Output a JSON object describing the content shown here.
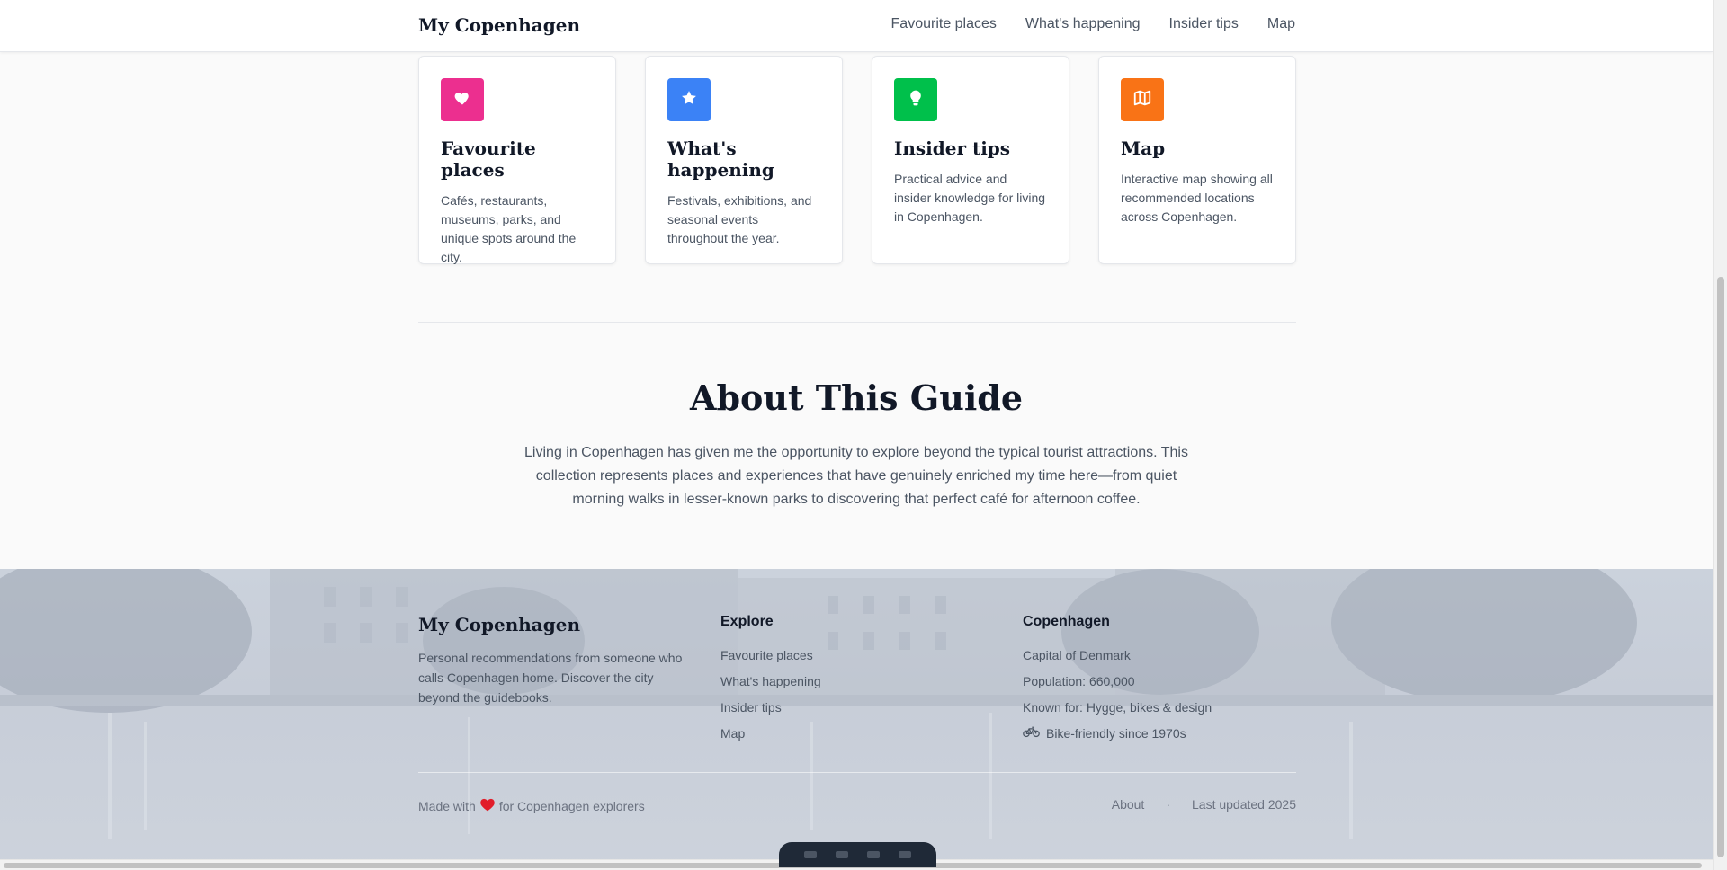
{
  "header": {
    "brand": "My Copenhagen",
    "nav": [
      "Favourite places",
      "What's happening",
      "Insider tips",
      "Map"
    ]
  },
  "cards": [
    {
      "icon": "heart-icon",
      "color": "#ec2f8f",
      "title": "Favourite places",
      "text": "Cafés, restaurants, museums, parks, and unique spots around the city."
    },
    {
      "icon": "star-icon",
      "color": "#3b82f6",
      "title": "What's happening",
      "text": "Festivals, exhibitions, and seasonal events throughout the year."
    },
    {
      "icon": "lightbulb-icon",
      "color": "#00c04b",
      "title": "Insider tips",
      "text": "Practical advice and insider knowledge for living in Copenhagen."
    },
    {
      "icon": "map-icon",
      "color": "#f97316",
      "title": "Map",
      "text": "Interactive map showing all recommended locations across Copenhagen."
    }
  ],
  "about": {
    "title": "About This Guide",
    "text": "Living in Copenhagen has given me the opportunity to explore beyond the typical tourist attractions. This collection represents places and experiences that have genuinely enriched my time here—from quiet morning walks in lesser-known parks to discovering that perfect café for afternoon coffee."
  },
  "footer": {
    "brand": "My Copenhagen",
    "description": "Personal recommendations from someone who calls Copenhagen home. Discover the city beyond the guidebooks.",
    "explore": {
      "heading": "Explore",
      "links": [
        "Favourite places",
        "What's happening",
        "Insider tips",
        "Map"
      ]
    },
    "city": {
      "heading": "Copenhagen",
      "facts": [
        "Capital of Denmark",
        "Population: 660,000",
        "Known for: Hygge, bikes & design"
      ],
      "bike_icon": "bicycle-icon",
      "bike_fact": "Bike-friendly since 1970s"
    },
    "made_prefix": "Made with",
    "made_icon": "heart-icon",
    "made_suffix": "for Copenhagen explorers",
    "about_link": "About",
    "separator": "·",
    "updated": "Last updated 2025"
  }
}
